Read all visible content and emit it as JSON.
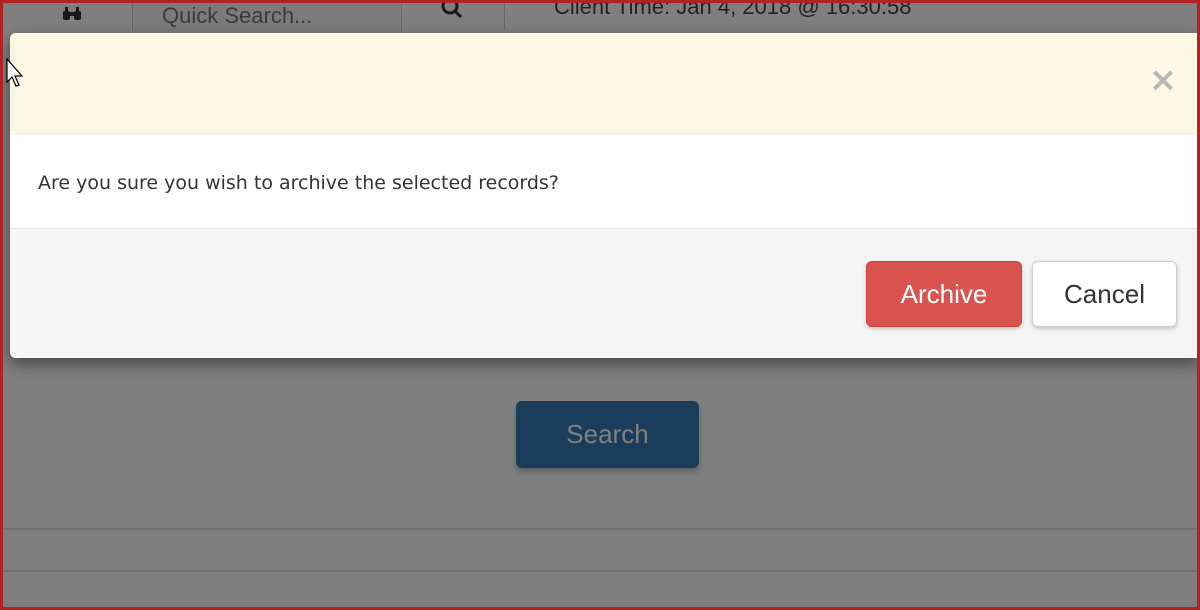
{
  "background": {
    "quick_search_placeholder": "Quick Search...",
    "client_time": "Client Time: Jan 4, 2018 @ 16:30:58",
    "search_button": "Search"
  },
  "modal": {
    "close_glyph": "×",
    "message": "Are you sure you wish to archive the selected records?",
    "archive_label": "Archive",
    "cancel_label": "Cancel"
  },
  "icons": {
    "binoculars": "binoculars-icon",
    "search": "search-icon",
    "close": "close-icon",
    "cursor": "mouse-cursor-icon"
  },
  "colors": {
    "header_bg": "#fcf8e3",
    "archive_bg": "#d9534f",
    "search_bg": "#337ab7",
    "frame": "#b22222"
  }
}
